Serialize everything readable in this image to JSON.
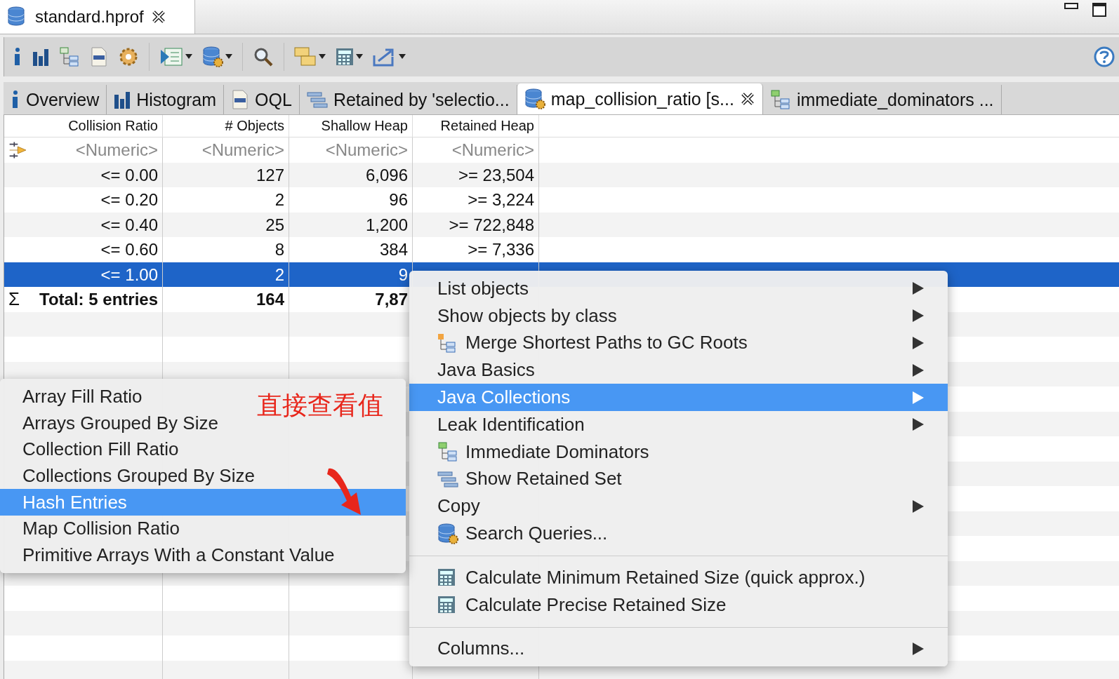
{
  "editor_tab": {
    "title": "standard.hprof"
  },
  "result_tabs": [
    {
      "label": "Overview",
      "selected": false
    },
    {
      "label": "Histogram",
      "selected": false
    },
    {
      "label": "OQL",
      "selected": false
    },
    {
      "label": "Retained by 'selectio...",
      "selected": false
    },
    {
      "label": "map_collision_ratio [s...",
      "selected": true
    },
    {
      "label": "immediate_dominators ...",
      "selected": false
    }
  ],
  "table": {
    "columns": [
      "Collision Ratio",
      "# Objects",
      "Shallow Heap",
      "Retained Heap"
    ],
    "filter_placeholders": [
      "<Numeric>",
      "<Numeric>",
      "<Numeric>",
      "<Numeric>"
    ],
    "rows": [
      {
        "cells": [
          "<= 0.00",
          "127",
          "6,096",
          ">= 23,504"
        ],
        "selected": false
      },
      {
        "cells": [
          "<= 0.20",
          "2",
          "96",
          ">= 3,224"
        ],
        "selected": false
      },
      {
        "cells": [
          "<= 0.40",
          "25",
          "1,200",
          ">= 722,848"
        ],
        "selected": false
      },
      {
        "cells": [
          "<= 0.60",
          "8",
          "384",
          ">= 7,336"
        ],
        "selected": false
      },
      {
        "cells": [
          "<= 1.00",
          "2",
          "9"
        ],
        "selected": true
      }
    ],
    "total": {
      "symbol": "Σ",
      "cells": [
        "Total: 5 entries",
        "164",
        "7,87"
      ]
    }
  },
  "context_menu": {
    "items": [
      {
        "kind": "item",
        "label": "List objects",
        "submenu": true,
        "selected": false
      },
      {
        "kind": "item",
        "label": "Show objects by class",
        "submenu": true,
        "selected": false
      },
      {
        "kind": "item",
        "label": "Merge Shortest Paths to GC Roots",
        "submenu": true,
        "selected": false
      },
      {
        "kind": "item",
        "label": "Java Basics",
        "submenu": true,
        "selected": false
      },
      {
        "kind": "item",
        "label": "Java Collections",
        "submenu": true,
        "selected": true
      },
      {
        "kind": "item",
        "label": "Leak Identification",
        "submenu": true,
        "selected": false
      },
      {
        "kind": "item",
        "label": "Immediate Dominators",
        "submenu": false,
        "selected": false
      },
      {
        "kind": "item",
        "label": "Show Retained Set",
        "submenu": false,
        "selected": false
      },
      {
        "kind": "item",
        "label": "Copy",
        "submenu": true,
        "selected": false
      },
      {
        "kind": "item",
        "label": "Search Queries...",
        "submenu": false,
        "selected": false
      },
      {
        "kind": "separator"
      },
      {
        "kind": "item",
        "label": "Calculate Minimum Retained Size (quick approx.)",
        "submenu": false,
        "selected": false
      },
      {
        "kind": "item",
        "label": "Calculate Precise Retained Size",
        "submenu": false,
        "selected": false
      },
      {
        "kind": "separator"
      },
      {
        "kind": "item",
        "label": "Columns...",
        "submenu": true,
        "selected": false
      }
    ]
  },
  "submenu": {
    "items": [
      {
        "label": "Array Fill Ratio",
        "selected": false
      },
      {
        "label": "Arrays Grouped By Size",
        "selected": false
      },
      {
        "label": "Collection Fill Ratio",
        "selected": false
      },
      {
        "label": "Collections Grouped By Size",
        "selected": false
      },
      {
        "label": "Hash Entries",
        "selected": true
      },
      {
        "label": "Map Collision Ratio",
        "selected": false
      },
      {
        "label": "Primitive Arrays With a Constant Value",
        "selected": false
      }
    ]
  },
  "annotation": {
    "text": "直接查看值"
  }
}
